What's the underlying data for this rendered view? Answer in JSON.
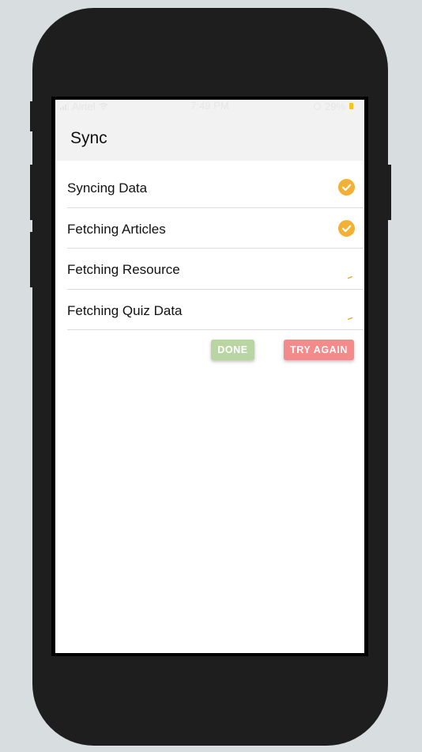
{
  "status_bar": {
    "carrier": "Airtel",
    "time": "7:49 PM",
    "battery_percent": "29%"
  },
  "nav": {
    "title": "Sync"
  },
  "sync_items": [
    {
      "label": "Syncing Data",
      "state": "done"
    },
    {
      "label": "Fetching Articles",
      "state": "done"
    },
    {
      "label": "Fetching Resource",
      "state": "loading"
    },
    {
      "label": "Fetching Quiz Data",
      "state": "loading"
    }
  ],
  "actions": {
    "done_label": "DONE",
    "try_again_label": "TRY AGAIN"
  },
  "colors": {
    "accent": "#f2b134",
    "done_button": "#b9d6a2",
    "try_again_button": "#f58a8a",
    "nav_background": "#f2f2f2"
  },
  "icons": {
    "done_state": "check-circle-icon",
    "loading_state": "spinner-icon"
  }
}
